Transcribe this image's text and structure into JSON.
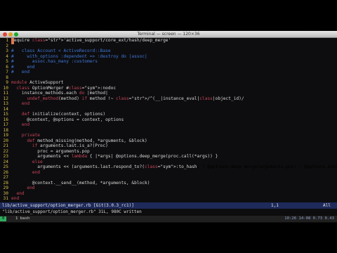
{
  "window": {
    "title": "Terminal — screen — 120×36"
  },
  "editor": {
    "lines": [
      {
        "num": "1",
        "text": "require 'active_support/core_ext/hash/deep_merge'"
      },
      {
        "num": "2",
        "text": ""
      },
      {
        "num": "3",
        "text": "#   class Account < ActiveRecord::Base"
      },
      {
        "num": "4",
        "text": "#     with_options :dependent => :destroy do |assoc|"
      },
      {
        "num": "5",
        "text": "#       assoc.has_many :customers"
      },
      {
        "num": "6",
        "text": "#     end"
      },
      {
        "num": "7",
        "text": "#   end"
      },
      {
        "num": "8",
        "text": ""
      },
      {
        "num": "9",
        "text": "module ActiveSupport"
      },
      {
        "num": "10",
        "text": "  class OptionMerger #:nodoc:"
      },
      {
        "num": "11",
        "text": "    instance_methods.each do |method|"
      },
      {
        "num": "12",
        "text": "      undef_method(method) if method !~ /^(__|instance_eval|class|object_id)/"
      },
      {
        "num": "13",
        "text": "    end"
      },
      {
        "num": "14",
        "text": ""
      },
      {
        "num": "15",
        "text": "    def initialize(context, options)"
      },
      {
        "num": "16",
        "text": "      @context, @options = context, options"
      },
      {
        "num": "17",
        "text": "    end"
      },
      {
        "num": "18",
        "text": ""
      },
      {
        "num": "19",
        "text": "    private"
      },
      {
        "num": "20",
        "text": "      def method_missing(method, *arguments, &block)"
      },
      {
        "num": "21",
        "text": "        if arguments.last.is_a?(Proc)"
      },
      {
        "num": "22",
        "text": "          proc = arguments.pop"
      },
      {
        "num": "23",
        "text": "          arguments << lambda { |*args| @options.deep_merge(proc.call(*args)) }"
      },
      {
        "num": "24",
        "text": "        else"
      },
      {
        "num": "25",
        "text": "          arguments << (arguments.last.respond_to?(:to_hash) ? @options.deep_merge(arguments.pop) : @options.dup)"
      },
      {
        "num": "26",
        "text": "        end"
      },
      {
        "num": "27",
        "text": ""
      },
      {
        "num": "28",
        "text": "        @context.__send__(method, *arguments, &block)"
      },
      {
        "num": "29",
        "text": "      end"
      },
      {
        "num": "30",
        "text": "  end"
      },
      {
        "num": "31",
        "text": "end"
      }
    ],
    "tilde": "~"
  },
  "statusbar": {
    "file": "lib/active_support/option_merger.rb [Git(3.0.3_rc1)]",
    "position": "1,1",
    "percent": "All"
  },
  "cmdline": "\"lib/active_support/option_merger.rb\" 31L, 980C written",
  "tmux": {
    "session": "0",
    "window": "1 bash",
    "right": "10:26 14-08 0.73 0.43"
  },
  "colors": {
    "keyword": "#c7465a",
    "string": "#cfd153",
    "comment": "#3f78d8",
    "linenumber": "#d6c04a",
    "cursor": "#e0794a",
    "statusbar": "#1e2a5a"
  }
}
